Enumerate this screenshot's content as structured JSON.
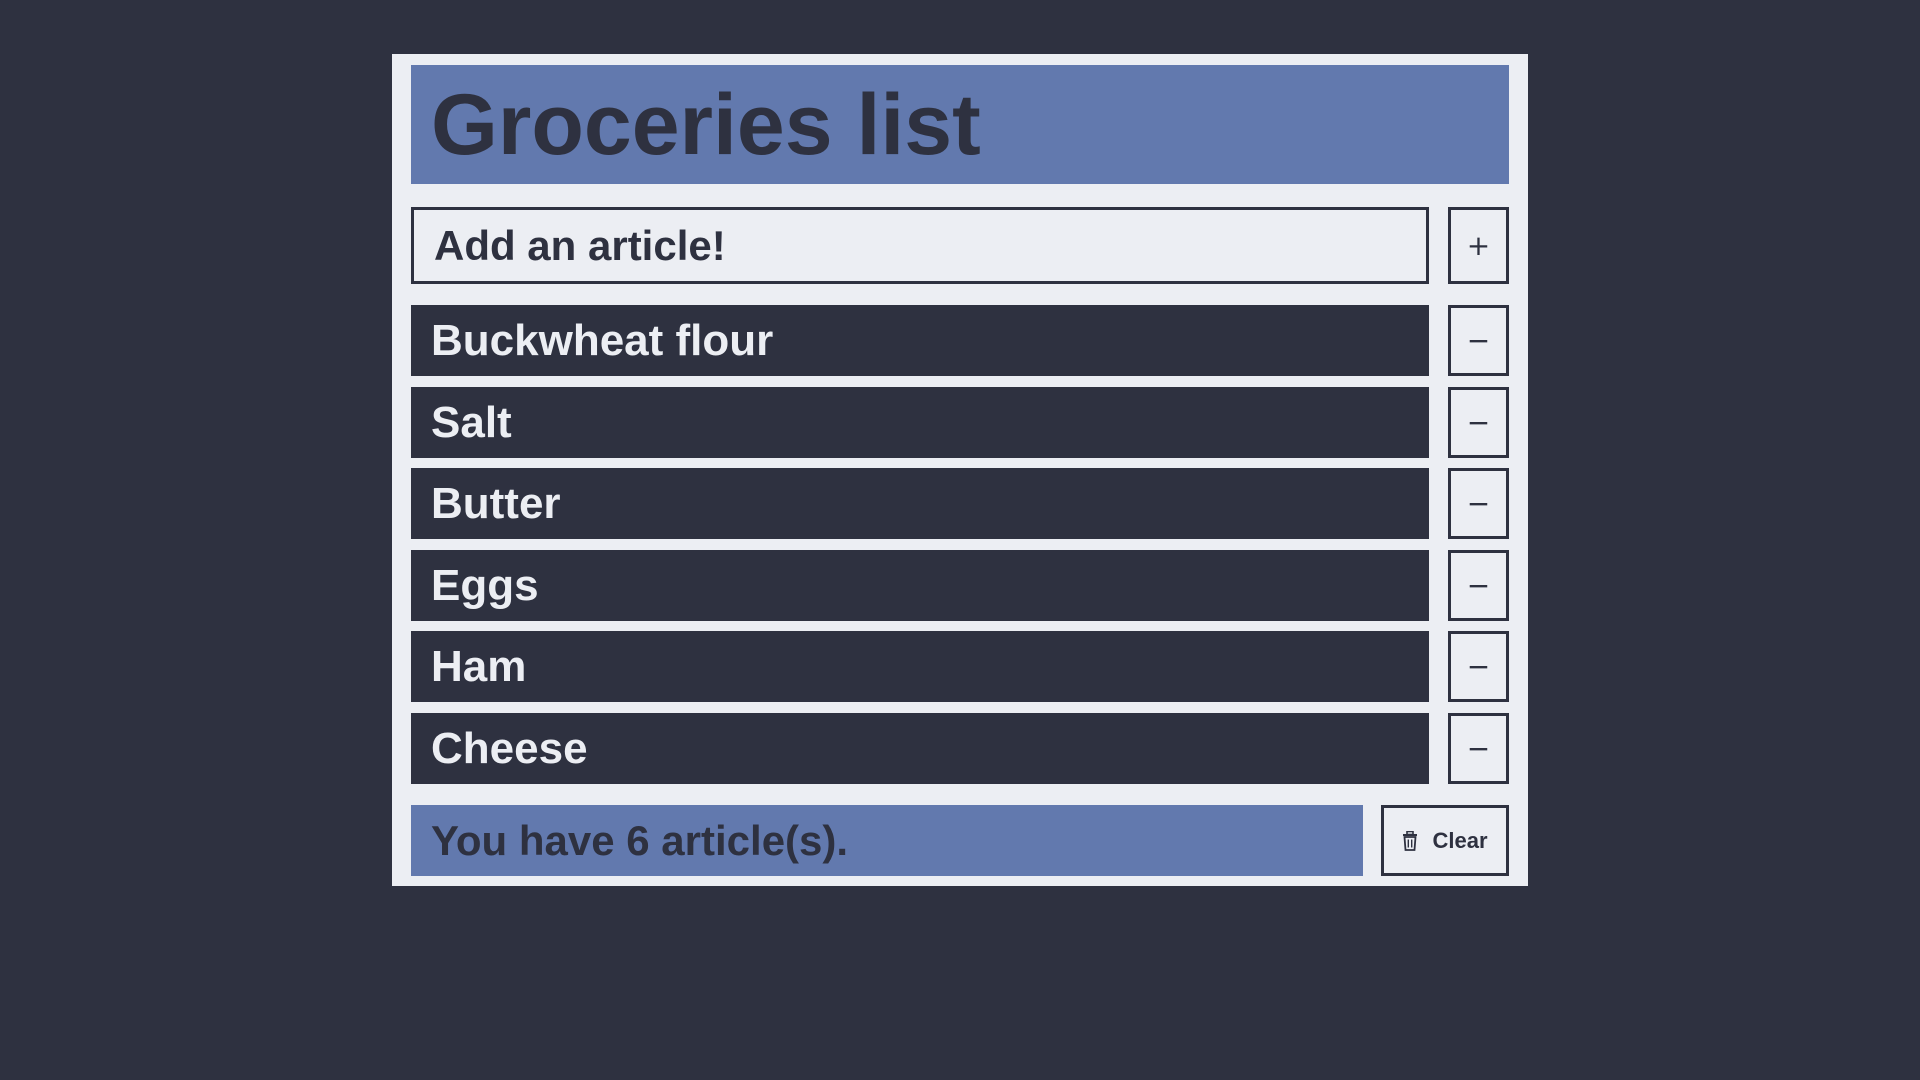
{
  "header": {
    "title": "Groceries list"
  },
  "add_form": {
    "input_placeholder": "Add an article!",
    "input_value": "",
    "add_button_label": "+",
    "add_button_icon": "plus-icon"
  },
  "items": [
    {
      "label": "Buckwheat flour",
      "remove_label": "−"
    },
    {
      "label": "Salt",
      "remove_label": "−"
    },
    {
      "label": "Butter",
      "remove_label": "−"
    },
    {
      "label": "Eggs",
      "remove_label": "−"
    },
    {
      "label": "Ham",
      "remove_label": "−"
    },
    {
      "label": "Cheese",
      "remove_label": "−"
    }
  ],
  "footer": {
    "count_text": "You have 6 article(s).",
    "clear_label": "Clear",
    "clear_icon": "trash-icon"
  },
  "colors": {
    "background": "#2e3140",
    "card": "#eceef3",
    "accent": "#6279ae",
    "item_background": "#2e3140",
    "item_text": "#eceef3"
  }
}
